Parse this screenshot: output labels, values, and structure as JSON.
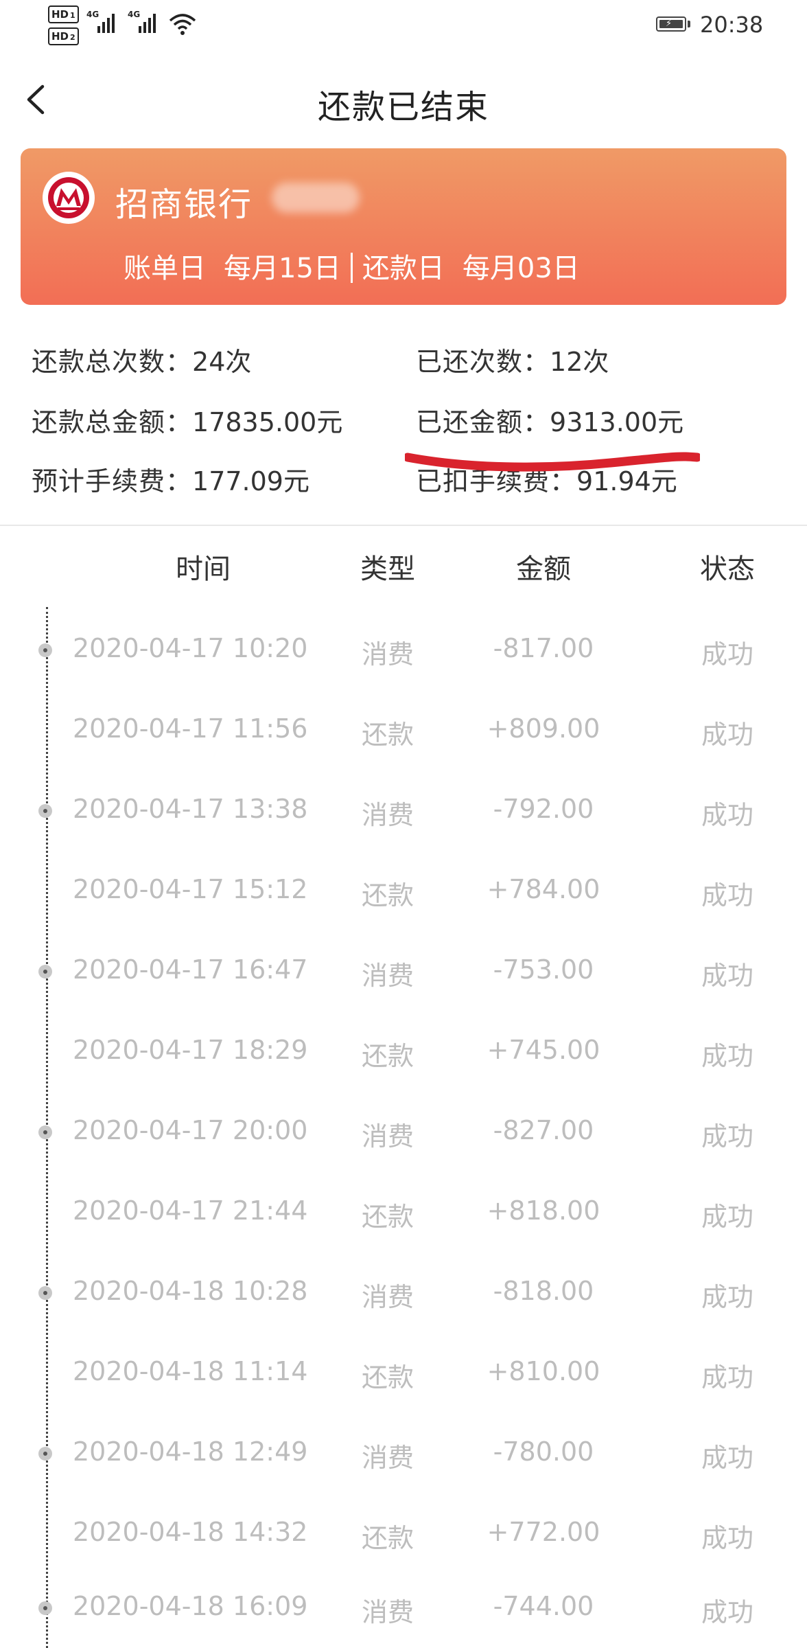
{
  "status_bar": {
    "hd1": "HD",
    "hd1_sub": "1",
    "hd2": "HD",
    "hd2_sub": "2",
    "net1": "4G",
    "net2": "4G",
    "time": "20:38"
  },
  "header": {
    "title": "还款已结束"
  },
  "card": {
    "bank_name": "招商银行",
    "bill_day_label": "账单日",
    "bill_day_value": "每月15日",
    "repay_day_label": "还款日",
    "repay_day_value": "每月03日",
    "colors": {
      "top": "#f09a66",
      "bottom": "#f26e55",
      "logo": "#c8102e"
    }
  },
  "summary": {
    "total_count": {
      "label": "还款总次数：",
      "value": "24次"
    },
    "paid_count": {
      "label": "已还次数：",
      "value": "12次"
    },
    "total_amount": {
      "label": "还款总金额：",
      "value": "17835.00元"
    },
    "paid_amount": {
      "label": "已还金额：",
      "value": "9313.00元"
    },
    "est_fee": {
      "label": "预计手续费：",
      "value": "177.09元"
    },
    "deducted_fee": {
      "label": "已扣手续费：",
      "value": "91.94元"
    }
  },
  "table": {
    "headers": {
      "time": "时间",
      "type": "类型",
      "amount": "金额",
      "status": "状态"
    },
    "rows": [
      {
        "time": "2020-04-17 10:20",
        "type": "消费",
        "amount": "-817.00",
        "status": "成功"
      },
      {
        "time": "2020-04-17 11:56",
        "type": "还款",
        "amount": "+809.00",
        "status": "成功"
      },
      {
        "time": "2020-04-17 13:38",
        "type": "消费",
        "amount": "-792.00",
        "status": "成功"
      },
      {
        "time": "2020-04-17 15:12",
        "type": "还款",
        "amount": "+784.00",
        "status": "成功"
      },
      {
        "time": "2020-04-17 16:47",
        "type": "消费",
        "amount": "-753.00",
        "status": "成功"
      },
      {
        "time": "2020-04-17 18:29",
        "type": "还款",
        "amount": "+745.00",
        "status": "成功"
      },
      {
        "time": "2020-04-17 20:00",
        "type": "消费",
        "amount": "-827.00",
        "status": "成功"
      },
      {
        "time": "2020-04-17 21:44",
        "type": "还款",
        "amount": "+818.00",
        "status": "成功"
      },
      {
        "time": "2020-04-18 10:28",
        "type": "消费",
        "amount": "-818.00",
        "status": "成功"
      },
      {
        "time": "2020-04-18 11:14",
        "type": "还款",
        "amount": "+810.00",
        "status": "成功"
      },
      {
        "time": "2020-04-18 12:49",
        "type": "消费",
        "amount": "-780.00",
        "status": "成功"
      },
      {
        "time": "2020-04-18 14:32",
        "type": "还款",
        "amount": "+772.00",
        "status": "成功"
      },
      {
        "time": "2020-04-18 16:09",
        "type": "消费",
        "amount": "-744.00",
        "status": "成功"
      }
    ]
  },
  "icons": {
    "back": "chevron-left-icon",
    "wifi": "wifi-icon",
    "battery": "battery-charging-icon",
    "signal": "signal-icon",
    "bank_logo": "cmb-logo-icon"
  },
  "annotation_color": "#d9232d"
}
